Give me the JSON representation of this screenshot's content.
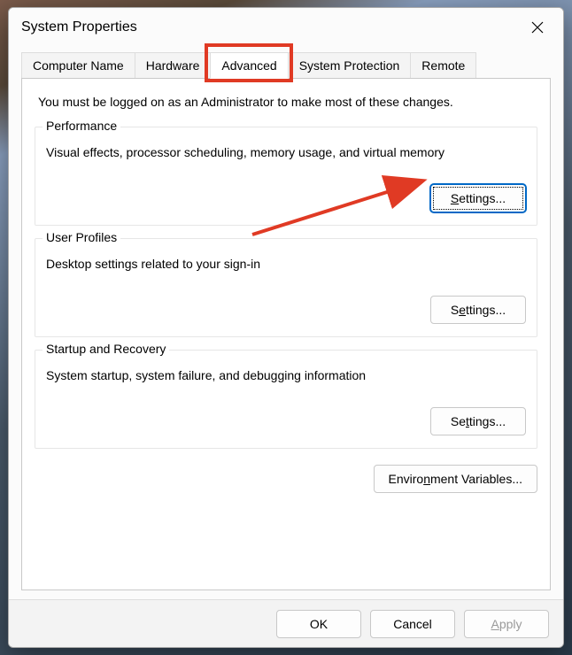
{
  "window": {
    "title": "System Properties"
  },
  "tabs": [
    {
      "id": "computer-name",
      "label": "Computer Name",
      "active": false
    },
    {
      "id": "hardware",
      "label": "Hardware",
      "active": false
    },
    {
      "id": "advanced",
      "label": "Advanced",
      "active": true
    },
    {
      "id": "system-protection",
      "label": "System Protection",
      "active": false
    },
    {
      "id": "remote",
      "label": "Remote",
      "active": false
    }
  ],
  "panel": {
    "admin_note": "You must be logged on as an Administrator to make most of these changes.",
    "performance": {
      "title": "Performance",
      "desc": "Visual effects, processor scheduling, memory usage, and virtual memory",
      "button_prefix": "",
      "button_mnemonic": "S",
      "button_suffix": "ettings..."
    },
    "user_profiles": {
      "title": "User Profiles",
      "desc": "Desktop settings related to your sign-in",
      "button_prefix": "S",
      "button_mnemonic": "e",
      "button_suffix": "ttings..."
    },
    "startup_recovery": {
      "title": "Startup and Recovery",
      "desc": "System startup, system failure, and debugging information",
      "button_prefix": "Se",
      "button_mnemonic": "t",
      "button_suffix": "tings..."
    },
    "env_vars": {
      "button_prefix": "Enviro",
      "button_mnemonic": "n",
      "button_suffix": "ment Variables..."
    }
  },
  "footer": {
    "ok": "OK",
    "cancel": "Cancel",
    "apply_mnemonic": "A",
    "apply_suffix": "pply"
  },
  "annotations": {
    "highlight_tab": "advanced",
    "arrow_target": "performance-settings"
  }
}
